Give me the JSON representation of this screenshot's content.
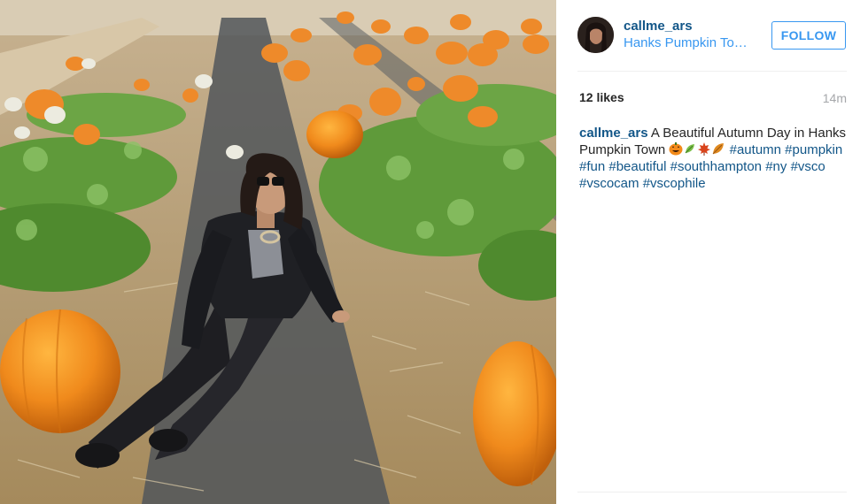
{
  "post": {
    "username": "callme_ars",
    "location": "Hanks Pumpkin To…",
    "follow_label": "FOLLOW",
    "likes": "12 likes",
    "time": "14m",
    "caption": {
      "author": "callme_ars",
      "text": "A Beautiful Autumn Day in Hanks Pumpkin Town",
      "emojis": [
        "jack-o-lantern",
        "herb",
        "maple-leaf",
        "fallen-leaf"
      ],
      "hashtags": [
        "#autumn",
        "#pumpkin",
        "#fun",
        "#beautiful",
        "#southhampton",
        "#ny",
        "#vsco",
        "#vscocam",
        "#vscophile"
      ]
    }
  },
  "photo": {
    "subject": "woman in sunglasses sitting in a pumpkin patch",
    "colors": {
      "pumpkin": "#f08a1c",
      "vine": "#5f9a3a",
      "straw": "#b59a6c",
      "plastic": "#4a4e52"
    }
  },
  "theme": {
    "link": "#125688",
    "accent": "#3897f0",
    "muted": "#a5a7aa",
    "divider": "#efefef"
  }
}
